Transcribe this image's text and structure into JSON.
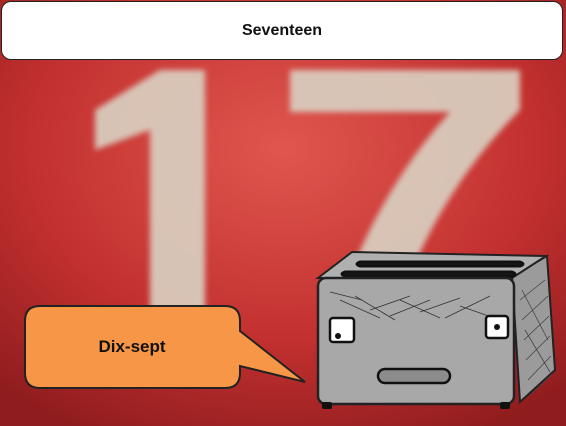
{
  "header": {
    "title": "Seventeen"
  },
  "background": {
    "number_text": "17",
    "color": "#b5292a"
  },
  "speech_bubble": {
    "label": "Dix-sept",
    "color": "#f79646"
  },
  "toaster": {
    "icon": "toaster-character-icon",
    "color": "#a8a8a8"
  }
}
